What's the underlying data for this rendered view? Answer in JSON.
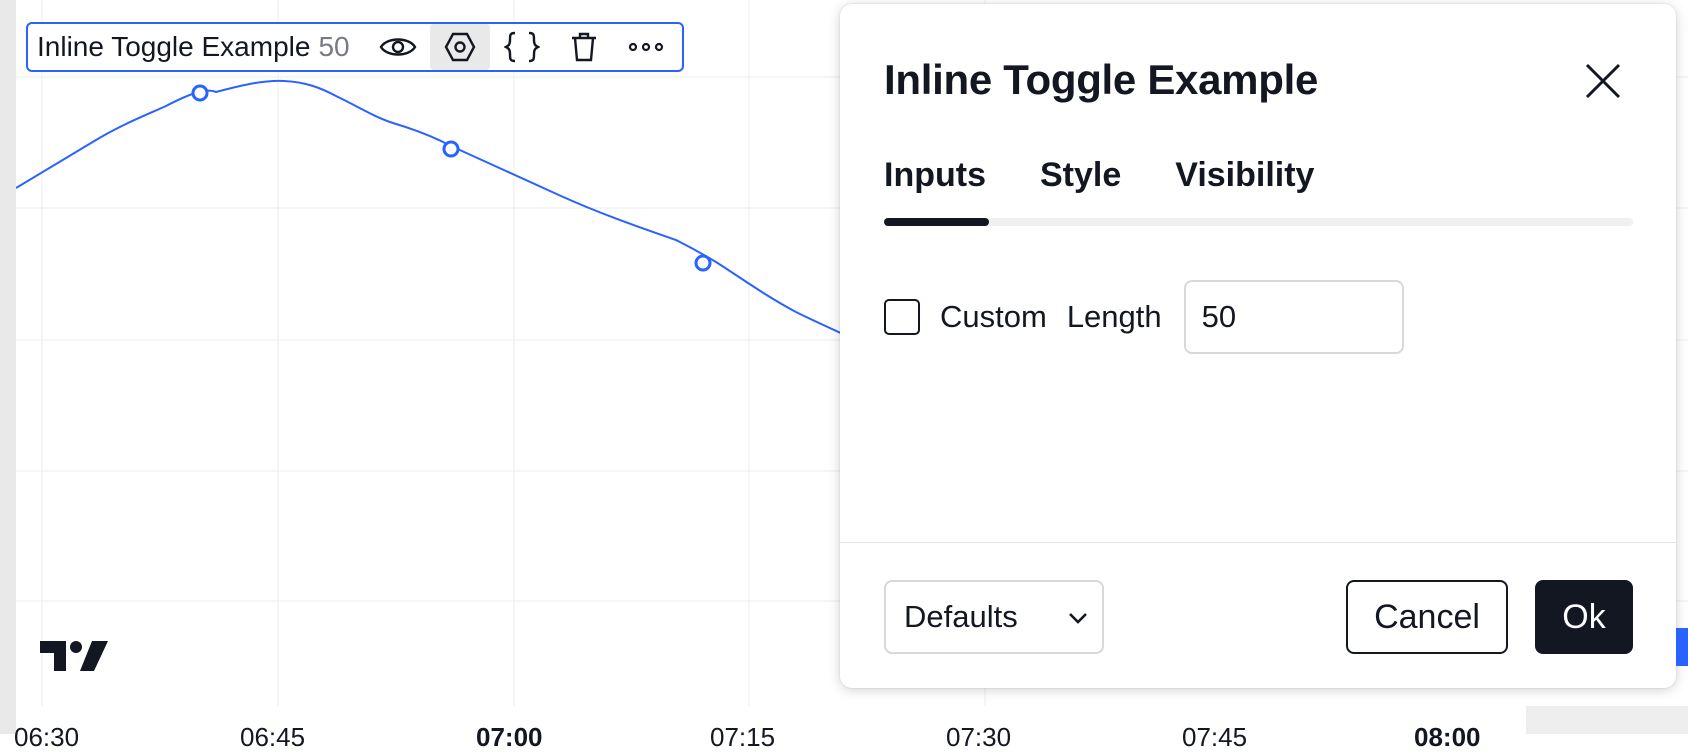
{
  "chart": {
    "series_color": "#2962ff",
    "time_axis": {
      "labels": [
        "06:30",
        "06:45",
        "07:00",
        "07:15",
        "07:30",
        "07:45",
        "08:00"
      ],
      "bold": [
        false,
        false,
        true,
        false,
        false,
        false,
        true
      ]
    }
  },
  "legend": {
    "title": "Inline Toggle Example",
    "value": "50",
    "buttons": [
      {
        "name": "eye-icon",
        "active": false
      },
      {
        "name": "settings-icon",
        "active": true
      },
      {
        "name": "source-code-icon",
        "active": false
      },
      {
        "name": "trash-icon",
        "active": false
      },
      {
        "name": "more-icon",
        "active": false
      }
    ]
  },
  "dialog": {
    "title": "Inline Toggle Example",
    "tabs": [
      "Inputs",
      "Style",
      "Visibility"
    ],
    "active_tab": "Inputs",
    "inputs": {
      "custom_label": "Custom",
      "custom_checked": false,
      "length_label": "Length",
      "length_value": "50"
    },
    "footer": {
      "defaults_label": "Defaults",
      "cancel_label": "Cancel",
      "ok_label": "Ok"
    }
  }
}
